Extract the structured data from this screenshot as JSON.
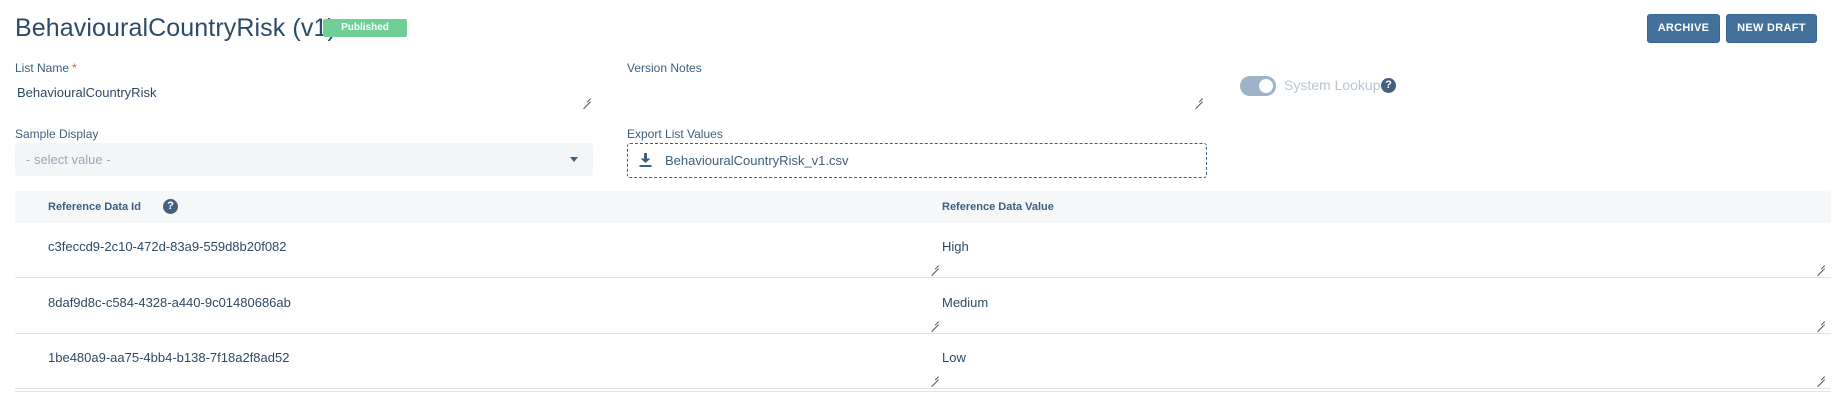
{
  "header": {
    "title": "BehaviouralCountryRisk (v1)",
    "status_badge": "Published",
    "archive_label": "ARCHIVE",
    "new_draft_label": "NEW DRAFT"
  },
  "form": {
    "list_name_label": "List Name",
    "required_marker": "*",
    "list_name_value": "BehaviouralCountryRisk",
    "version_notes_label": "Version Notes",
    "version_notes_value": "",
    "system_lookup_label": "System Lookup",
    "system_lookup_enabled": true,
    "sample_display_label": "Sample Display",
    "sample_display_placeholder": "- select value -",
    "export_label": "Export List Values",
    "export_file": "BehaviouralCountryRisk_v1.csv"
  },
  "table": {
    "columns": [
      "Reference Data Id",
      "Reference Data Value"
    ],
    "rows": [
      {
        "id": "c3feccd9-2c10-472d-83a9-559d8b20f082",
        "value": "High"
      },
      {
        "id": "8daf9d8c-c584-4328-a440-9c01480686ab",
        "value": "Medium"
      },
      {
        "id": "1be480a9-aa75-4bb4-b138-7f18a2f8ad52",
        "value": "Low"
      }
    ]
  },
  "icons": {
    "help": "question-circle-icon",
    "download": "download-icon",
    "caret": "caret-down-icon"
  },
  "colors": {
    "primary": "#44719c",
    "published": "#6fcf97",
    "required": "#e05252",
    "toggle": "#9eb3c8"
  }
}
